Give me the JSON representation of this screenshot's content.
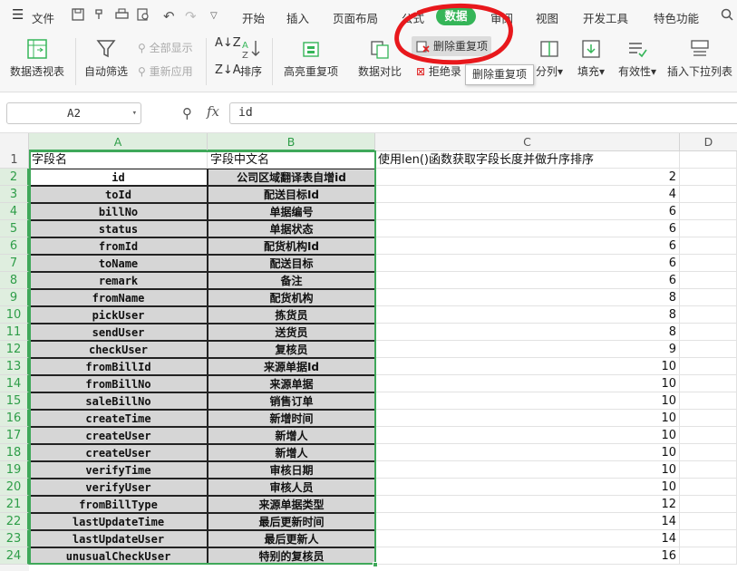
{
  "menubar": {
    "file_label": "文件",
    "tabs": [
      "开始",
      "插入",
      "页面布局",
      "公式",
      "数据",
      "审阅",
      "视图",
      "开发工具",
      "特色功能"
    ],
    "active_tab": "数据"
  },
  "ribbon": {
    "pivot_table": "数据透视表",
    "auto_filter": "自动筛选",
    "show_all": "全部显示",
    "reapply": "重新应用",
    "sort": "排序",
    "highlight_duplicates": "高亮重复项",
    "data_compare": "数据对比",
    "remove_duplicates": "删除重复项",
    "reject_duplicates": "拒绝录",
    "split": "分列",
    "fill": "填充",
    "validity": "有效性",
    "insert_dropdown": "插入下拉列表",
    "tooltip": "删除重复项"
  },
  "formula_bar": {
    "name_box": "A2",
    "fx": "fx",
    "content": "id"
  },
  "sheet": {
    "columns": [
      "A",
      "B",
      "C",
      "D"
    ],
    "header_row": {
      "a": "字段名",
      "b": "字段中文名",
      "c": "使用len()函数获取字段长度并做升序排序"
    },
    "rows": [
      {
        "a": "id",
        "b": "公司区域翻译表自增id",
        "c": "2"
      },
      {
        "a": "toId",
        "b": "配送目标Id",
        "c": "4"
      },
      {
        "a": "billNo",
        "b": "单据编号",
        "c": "6"
      },
      {
        "a": "status",
        "b": "单据状态",
        "c": "6"
      },
      {
        "a": "fromId",
        "b": "配货机构Id",
        "c": "6"
      },
      {
        "a": "toName",
        "b": "配送目标",
        "c": "6"
      },
      {
        "a": "remark",
        "b": "备注",
        "c": "6"
      },
      {
        "a": "fromName",
        "b": "配货机构",
        "c": "8"
      },
      {
        "a": "pickUser",
        "b": "拣货员",
        "c": "8"
      },
      {
        "a": "sendUser",
        "b": "送货员",
        "c": "8"
      },
      {
        "a": "checkUser",
        "b": "复核员",
        "c": "9"
      },
      {
        "a": "fromBillId",
        "b": "来源单据Id",
        "c": "10"
      },
      {
        "a": "fromBillNo",
        "b": "来源单据",
        "c": "10"
      },
      {
        "a": "saleBillNo",
        "b": "销售订单",
        "c": "10"
      },
      {
        "a": "createTime",
        "b": "新增时间",
        "c": "10"
      },
      {
        "a": "createUser",
        "b": "新增人",
        "c": "10"
      },
      {
        "a": "createUser",
        "b": "新增人",
        "c": "10"
      },
      {
        "a": "verifyTime",
        "b": "审核日期",
        "c": "10"
      },
      {
        "a": "verifyUser",
        "b": "审核人员",
        "c": "10"
      },
      {
        "a": "fromBillType",
        "b": "来源单据类型",
        "c": "12"
      },
      {
        "a": "lastUpdateTime",
        "b": "最后更新时间",
        "c": "14"
      },
      {
        "a": "lastUpdateUser",
        "b": "最后更新人",
        "c": "14"
      },
      {
        "a": "unusualCheckUser",
        "b": "特别的复核员",
        "c": "16"
      }
    ]
  },
  "colors": {
    "accent": "#35b558",
    "selection": "#3fa85a",
    "annotation_red": "#e8181c"
  }
}
